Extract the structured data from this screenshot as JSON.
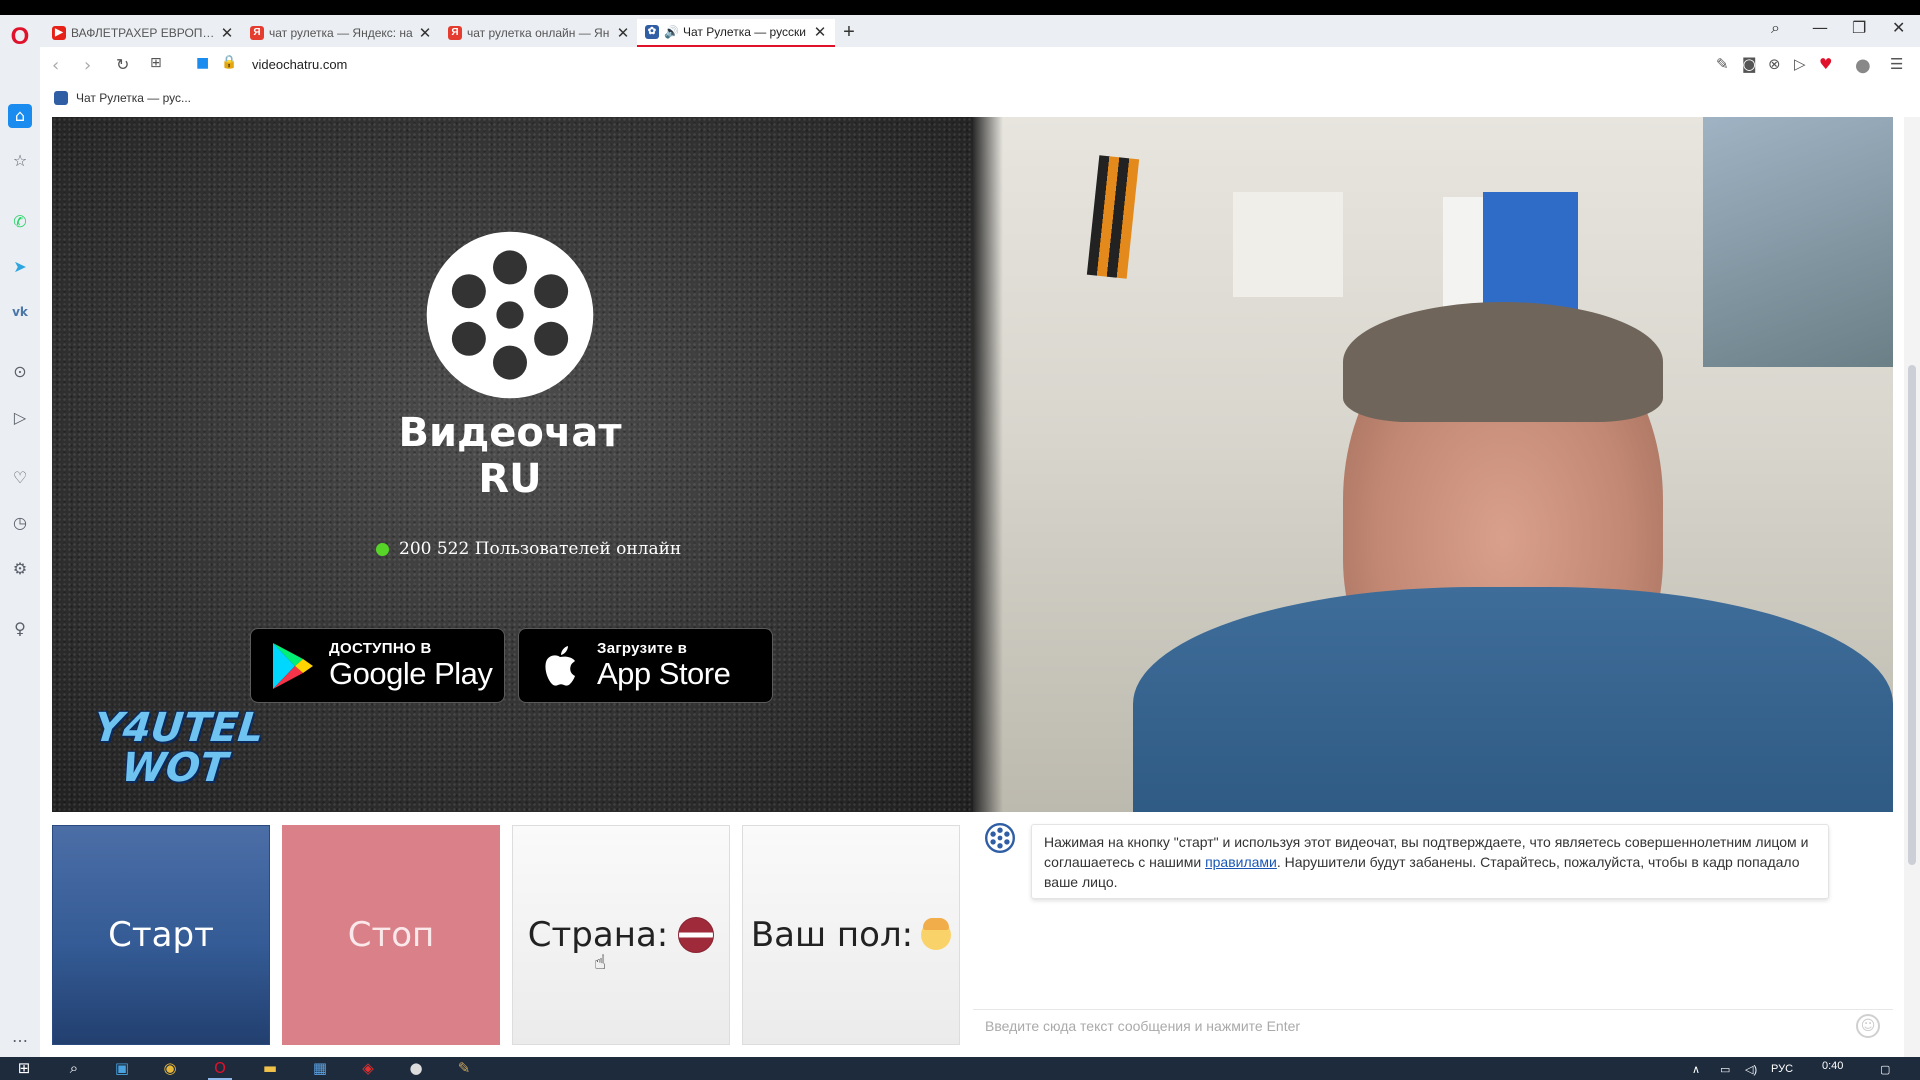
{
  "browser": {
    "tabs": [
      {
        "title": "ВАФЛЕТРАХЕР ЕВРОПЕЙС",
        "favicon": "youtube-icon",
        "color": "#e62117",
        "active": false
      },
      {
        "title": "чат рулетка — Яндекс: на",
        "favicon": "yandex-icon",
        "color": "#e43d30",
        "active": false
      },
      {
        "title": "чат рулетка онлайн — Ян",
        "favicon": "yandex-icon",
        "color": "#e43d30",
        "active": false
      },
      {
        "title": "Чат Рулетка — русски",
        "favicon": "videochat-icon",
        "color": "#2f5ea4",
        "active": true
      }
    ],
    "url": "videochatru.com",
    "bookmark": "Чат Рулетка — рус..."
  },
  "hero": {
    "title": "Видеочат RU",
    "online_text": "200 522 Пользователей онлайн",
    "google_play": {
      "small": "ДОСТУПНО В",
      "big": "Google Play"
    },
    "app_store": {
      "small": "Загрузите в",
      "big": "App Store"
    },
    "watermark_line1": "Y4UTEL",
    "watermark_line2": "WOT"
  },
  "controls": {
    "start_label": "Старт",
    "stop_label": "Стоп",
    "country_label": "Страна:",
    "gender_label": "Ваш пол:"
  },
  "chat": {
    "message_before": "Нажимая на кнопку \"старт\" и используя этот видеочат, вы подтверждаете, что являетесь совершеннолетним лицом и соглашаетесь с нашими ",
    "rules_link": "правилами",
    "message_after": ". Нарушители будут забанены. Старайтесь, пожалуйста, чтобы в кадр попадало ваше лицо.",
    "input_placeholder": "Введите сюда текст сообщения и нажмите Enter"
  },
  "taskbar": {
    "lang": "РУС",
    "time": "0:40"
  },
  "colors": {
    "start": "#345b95",
    "stop": "#d98088",
    "online_dot": "#56d428",
    "opera_red": "#e0112b"
  }
}
